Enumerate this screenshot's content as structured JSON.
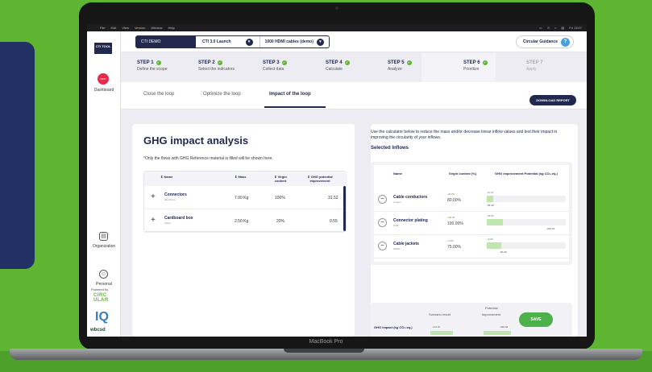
{
  "device": {
    "label": "MacBook Pro"
  },
  "menubar": {
    "items": [
      "File",
      "Edit",
      "View",
      "Version",
      "Window",
      "Help"
    ],
    "status": [
      "▭",
      "⊙",
      "⌕",
      "▤",
      "Fri 13:07"
    ]
  },
  "sidebar": {
    "logo": "CTI TOOL",
    "dashboard_badge": "NEW",
    "dashboard_label": "Dashboard",
    "organization_label": "Organization",
    "personal_label": "Personal",
    "powered_by": "Powered by",
    "circular_logo": "CIRC ULAR",
    "iq_logo": "IQ",
    "wbcsd_logo": "wbcsd"
  },
  "topbar": {
    "project": "CTI DEMO",
    "launch": "CTI 3.0 Launch",
    "product": "1000 HDMI cables (demo)",
    "circular_guidance": "Circular Guidance"
  },
  "steps": [
    {
      "title": "STEP 1",
      "subtitle": "Define the scope",
      "done": true
    },
    {
      "title": "STEP 2",
      "subtitle": "Select the indicators",
      "done": true
    },
    {
      "title": "STEP 3",
      "subtitle": "Collect data",
      "done": true
    },
    {
      "title": "STEP 4",
      "subtitle": "Calculate",
      "done": true
    },
    {
      "title": "STEP 5",
      "subtitle": "Analyze",
      "done": true
    },
    {
      "title": "STEP 6",
      "subtitle": "Prioritize",
      "done": true
    },
    {
      "title": "STEP 7",
      "subtitle": "Apply",
      "done": false
    }
  ],
  "tabs": {
    "close": "Close the loop",
    "optimize": "Optimize the loop",
    "impact": "Impact of the loop",
    "download": "DOWNLOAD REPORT"
  },
  "ghg": {
    "title": "GHG impact analysis",
    "note": "*Only the flows with GHG Reference material is filled will be shown here.",
    "headers": [
      "Name",
      "Mass",
      "Virgin content",
      "GHG potential improvement"
    ],
    "rows": [
      {
        "name": "Connectors",
        "sub": "Aluminum",
        "mass": "7.00 Kg",
        "virgin": "100%",
        "ghg": "31.52"
      },
      {
        "name": "Cardboard box",
        "sub": "Paper",
        "mass": "2.50 Kg",
        "virgin": "20%",
        "ghg": "0.55"
      }
    ]
  },
  "calculator": {
    "intro": "Use the calculator below to reduce the mass and/or decrease linear inflow values and test their impact in improving the circularity of your inflows.",
    "selected_title": "Selected Inflows",
    "headers": {
      "name": "Name",
      "virgin": "Virgin content (%)",
      "ghg": "GHG improvement Potential (kg CO₂-eq.)"
    },
    "rows": [
      {
        "name": "Cable conductors",
        "sub": "Copper",
        "virgin_delta": "-20.00",
        "virgin": "80.00%",
        "ghg_delta": "-10.01",
        "ghg_value": "-35.38",
        "fill": 0.08
      },
      {
        "name": "Connector plating",
        "sub": "Gold",
        "virgin_delta": "+00.00",
        "virgin": "100.00%",
        "ghg_delta": "-64.83",
        "ghg_value": "-233.24",
        "fill": 0.2
      },
      {
        "name": "Cable jackets",
        "sub": "HDPE",
        "virgin_delta": "+0.00",
        "virgin": "75.00%",
        "ghg_delta": "+5.00",
        "ghg_value": "-60.49",
        "fill": 0.18
      }
    ],
    "scenario": {
      "potential_label": "Potential",
      "improvement_label": "improvement",
      "result_label": "Scenario result",
      "ghg_label": "GHG impact (kg CO₂-eq.)",
      "result_value": "-129.00",
      "improvement_value": "-440.02",
      "save": "SAVE"
    }
  },
  "colors": {
    "brand_navy": "#22294f",
    "accent_green": "#5db531",
    "badge_red": "#e8294a"
  }
}
